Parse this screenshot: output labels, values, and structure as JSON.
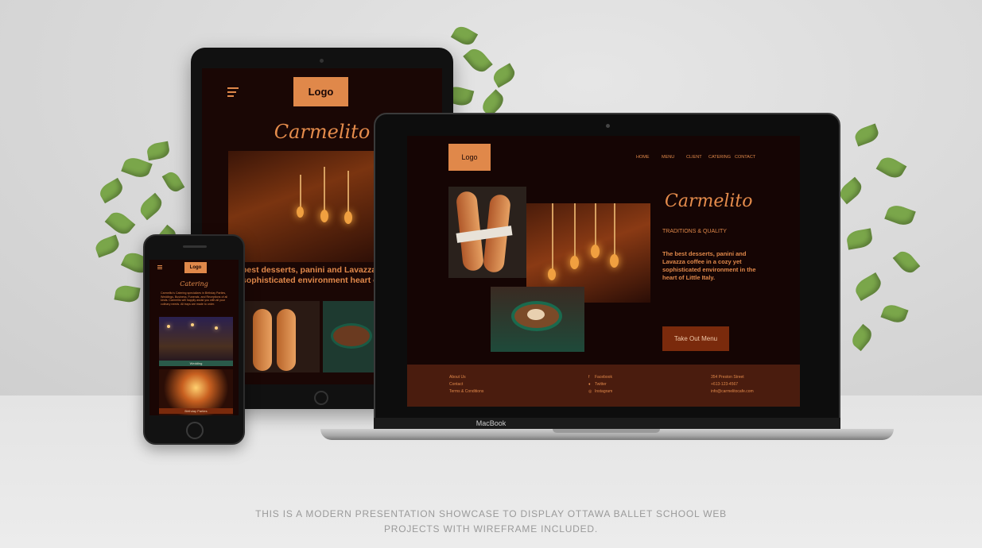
{
  "brand_name": "Carmelito",
  "logo_label": "Logo",
  "laptop": {
    "nav": [
      "HOME",
      "MENU",
      "CLIENT",
      "CATERING",
      "CONTACT"
    ],
    "tagline": "TRADITIONS & QUALITY",
    "description": "The best desserts, panini and Lavazza coffee in a cozy yet sophisticated environment in the heart of Little Italy.",
    "cta": "Take Out Menu",
    "footer": {
      "links": [
        "About Us",
        "Contact",
        "Terms & Conditions"
      ],
      "social": [
        "Facebook",
        "Twitter",
        "Instagram"
      ],
      "address": [
        "354 Preston Street",
        "+613-123-4567",
        "info@carmelitocafe.com"
      ]
    },
    "brand_label": "MacBook"
  },
  "tablet": {
    "description": "best desserts, panini and Lavazza cozy yet sophisticated environment heart of Little Italy."
  },
  "phone": {
    "section_title": "Catering",
    "body": "Carmelito's Catering specializes in Birthday Parties, Weddings, Business, Funerals, and Receptions of all kinds. Carmelito will happily assist you with all your culinary needs. All trays are made to order.",
    "cards": [
      "Wedding",
      "Birthday Parties"
    ]
  },
  "caption": "THIS IS A MODERN PRESENTATION SHOWCASE TO DISPLAY OTTAWA BALLET SCHOOL WEB PROJECTS WITH WIREFRAME INCLUDED.",
  "colors": {
    "accent": "#e0884a",
    "dark_bg": "#150504",
    "footer_bg": "#4a1c0e",
    "cta_bg": "#7a2a0c"
  }
}
